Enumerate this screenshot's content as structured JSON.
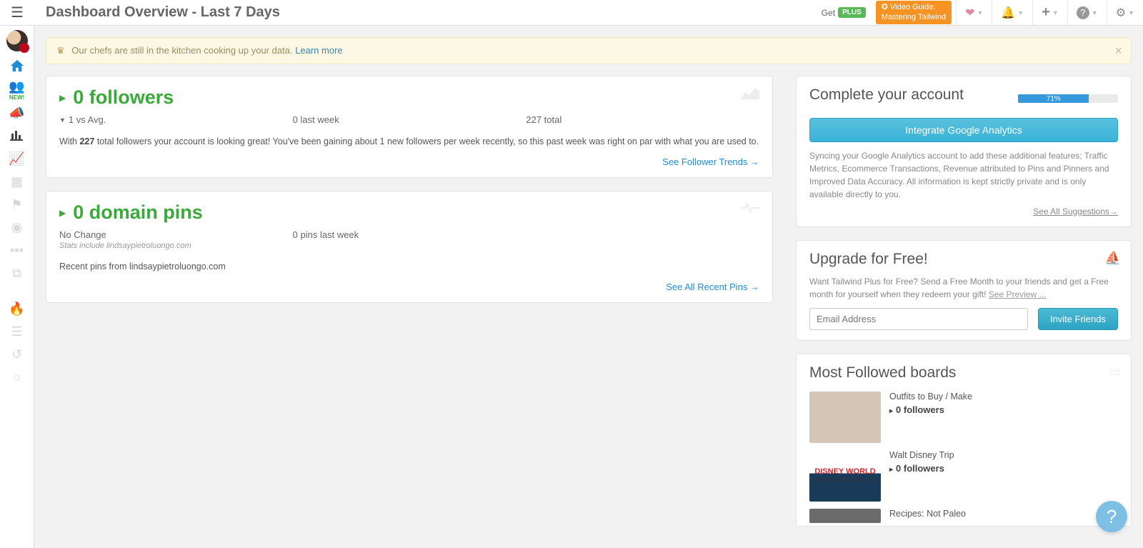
{
  "header": {
    "title": "Dashboard Overview - Last 7 Days",
    "get_label": "Get",
    "plus_label": "PLUS",
    "video_guide_line1": "✪ Video Guide:",
    "video_guide_line2": "Mastering Tailwind"
  },
  "sidebar": {
    "new_label": "NEW!"
  },
  "notice": {
    "text": "Our chefs are still in the kitchen cooking up your data.",
    "link": "Learn more"
  },
  "followers_card": {
    "title": "0 followers",
    "vs_avg": "1 vs Avg.",
    "last_week": "0 last week",
    "total": "227 total",
    "paragraph_pre": "With ",
    "paragraph_bold": "227",
    "paragraph_post": " total followers your account is looking great! You've been gaining about 1 new followers per week recently, so this past week was right on par with what you are used to.",
    "link": "See Follower Trends →"
  },
  "pins_card": {
    "title": "0 domain pins",
    "no_change": "No Change",
    "last_week": "0 pins last week",
    "stats_note": "Stats include lindsaypietroluongo.com",
    "recent_label": "Recent pins from lindsaypietroluongo.com",
    "link": "See All Recent Pins →"
  },
  "complete": {
    "heading": "Complete your account",
    "progress_label": "71%",
    "progress_pct": 71,
    "button": "Integrate Google Analytics",
    "desc": "Syncing your Google Analytics account to add these additional features; Traffic Metrics, Ecommerce Transactions, Revenue attributed to Pins and Pinners and Improved Data Accuracy. All information is kept strictly private and is only available directly to you.",
    "see_all": "See All Suggestions→"
  },
  "upgrade": {
    "heading": "Upgrade for Free!",
    "desc": "Want Tailwind Plus for Free? Send a Free Month to your friends and get a Free month for yourself when they redeem your gift! ",
    "preview": "See Preview ...",
    "placeholder": "Email Address",
    "button": "Invite Friends"
  },
  "boards": {
    "heading": "Most Followed boards",
    "items": [
      {
        "name": "Outfits to Buy / Make",
        "followers": "0 followers"
      },
      {
        "name": "Walt Disney Trip",
        "followers": "0 followers",
        "thumb_text": "DISNEY WORLD"
      },
      {
        "name": "Recipes: Not Paleo",
        "followers": ""
      }
    ]
  }
}
